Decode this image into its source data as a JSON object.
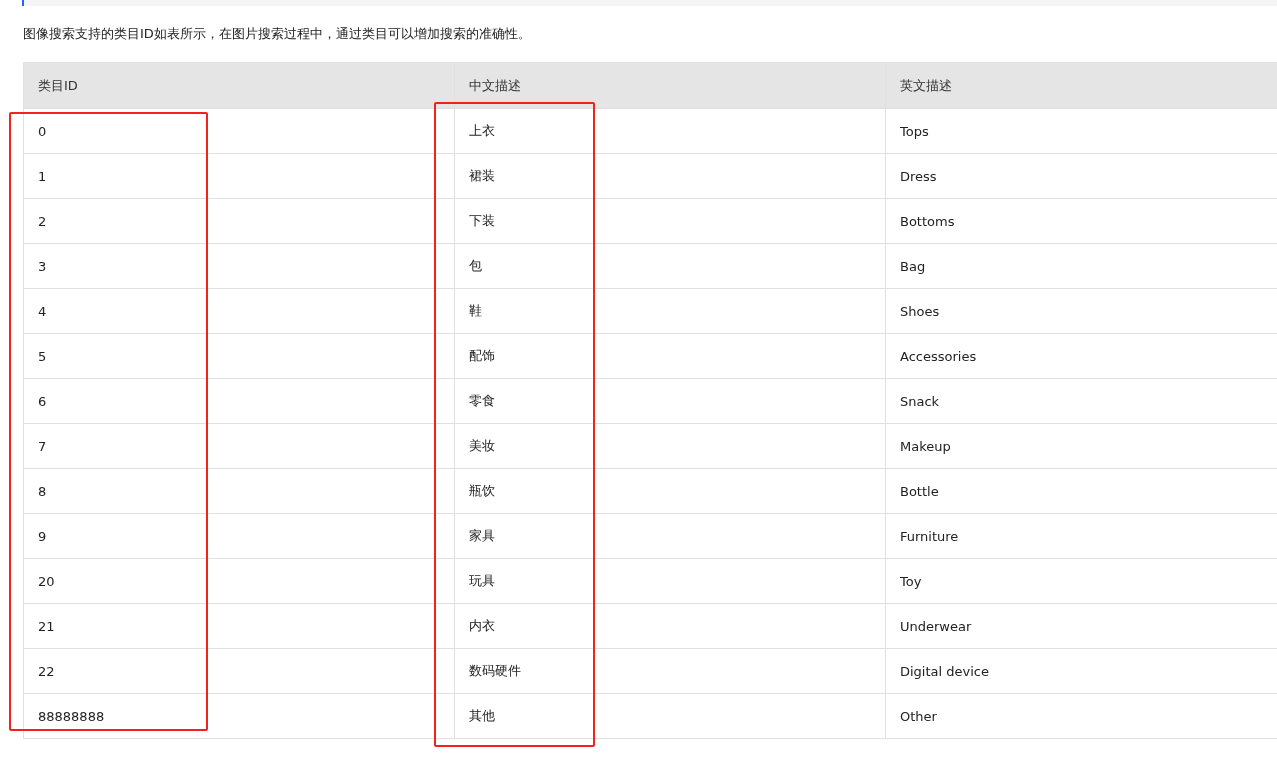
{
  "intro": "图像搜索支持的类目ID如表所示，在图片搜索过程中，通过类目可以增加搜索的准确性。",
  "table": {
    "columns": [
      "类目ID",
      "中文描述",
      "英文描述"
    ],
    "rows": [
      [
        "0",
        "上衣",
        "Tops"
      ],
      [
        "1",
        "裙装",
        "Dress"
      ],
      [
        "2",
        "下装",
        "Bottoms"
      ],
      [
        "3",
        "包",
        "Bag"
      ],
      [
        "4",
        "鞋",
        "Shoes"
      ],
      [
        "5",
        "配饰",
        "Accessories"
      ],
      [
        "6",
        "零食",
        "Snack"
      ],
      [
        "7",
        "美妆",
        "Makeup"
      ],
      [
        "8",
        "瓶饮",
        "Bottle"
      ],
      [
        "9",
        "家具",
        "Furniture"
      ],
      [
        "20",
        "玩具",
        "Toy"
      ],
      [
        "21",
        "内衣",
        "Underwear"
      ],
      [
        "22",
        "数码硬件",
        "Digital device"
      ],
      [
        "88888888",
        "其他",
        "Other"
      ]
    ]
  }
}
